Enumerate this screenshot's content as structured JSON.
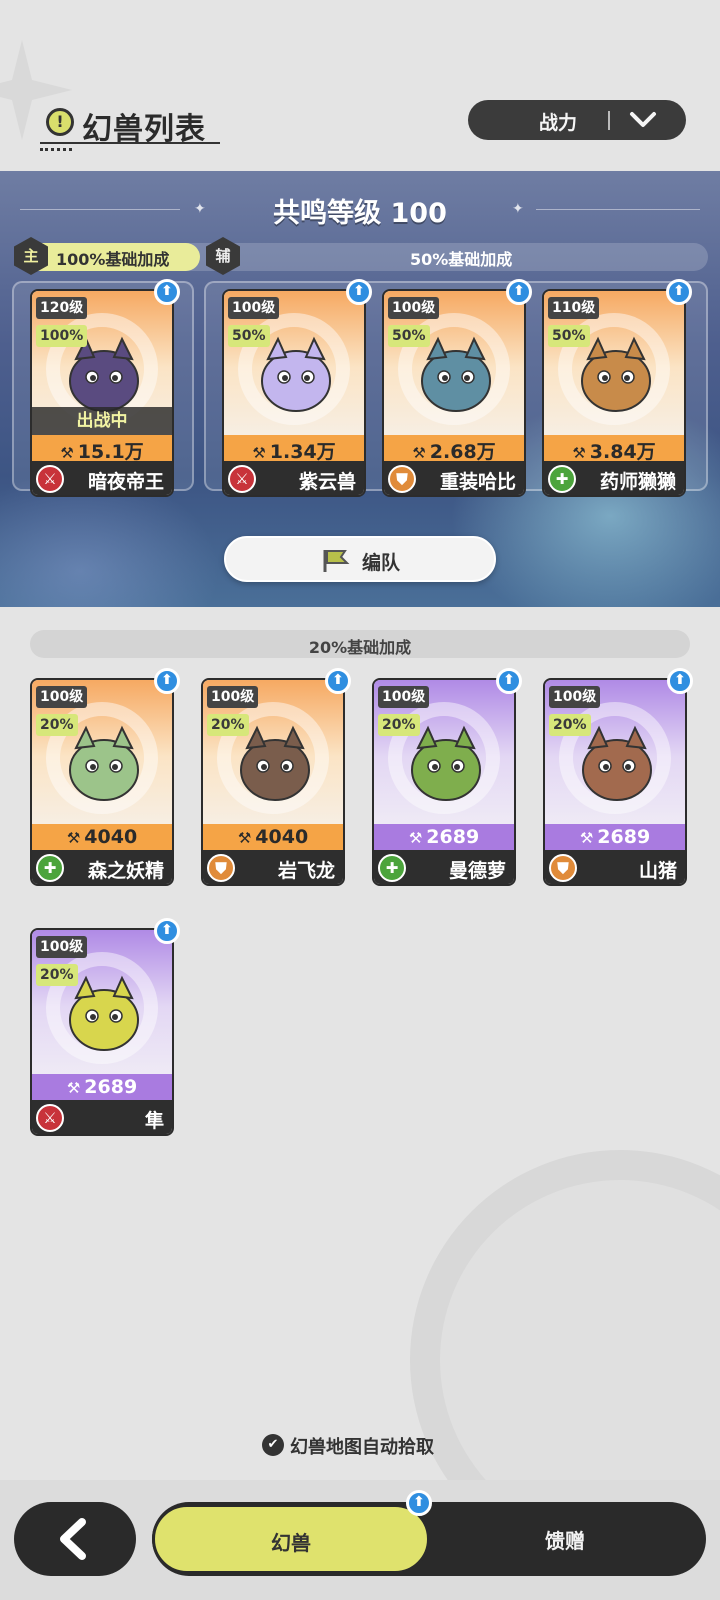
{
  "header": {
    "title": "幻兽列表",
    "title_icon": "!",
    "sort_label": "战力"
  },
  "resonance": {
    "title": "共鸣等级 100",
    "main_tag": "主",
    "main_bonus": "100%基础加成",
    "sub_tag": "辅",
    "sub_bonus": "50%基础加成",
    "team_button": "编队",
    "deployed_label": "出战中"
  },
  "main_cards": [
    {
      "level": "120级",
      "pct": "100%",
      "power": "15.1万",
      "name": "暗夜帝王",
      "role": "attack",
      "role_icon": "⚔",
      "theme": "orange",
      "color": "#5a4b80"
    }
  ],
  "sub_cards": [
    {
      "level": "100级",
      "pct": "50%",
      "power": "1.34万",
      "name": "紫云兽",
      "role": "attack",
      "role_icon": "⚔",
      "theme": "orange",
      "color": "#c3b6ee"
    },
    {
      "level": "100级",
      "pct": "50%",
      "power": "2.68万",
      "name": "重装哈比",
      "role": "defense",
      "role_icon": "⛊",
      "theme": "orange",
      "color": "#5f8fa3"
    },
    {
      "level": "110级",
      "pct": "50%",
      "power": "3.84万",
      "name": "药师獭獭",
      "role": "heal",
      "role_icon": "✚",
      "theme": "orange",
      "color": "#c88b4a"
    }
  ],
  "reserve": {
    "bonus": "20%基础加成",
    "cards": [
      {
        "level": "100级",
        "pct": "20%",
        "power": "4040",
        "name": "森之妖精",
        "role": "heal",
        "role_icon": "✚",
        "theme": "orange",
        "color": "#9cc48a"
      },
      {
        "level": "100级",
        "pct": "20%",
        "power": "4040",
        "name": "岩飞龙",
        "role": "defense",
        "role_icon": "⛊",
        "theme": "orange",
        "color": "#7a5d4c"
      },
      {
        "level": "100级",
        "pct": "20%",
        "power": "2689",
        "name": "曼德萝",
        "role": "heal",
        "role_icon": "✚",
        "theme": "purple",
        "color": "#7fae4d"
      },
      {
        "level": "100级",
        "pct": "20%",
        "power": "2689",
        "name": "山猪",
        "role": "defense",
        "role_icon": "⛊",
        "theme": "purple",
        "color": "#a26a4e"
      },
      {
        "level": "100级",
        "pct": "20%",
        "power": "2689",
        "name": "隼",
        "role": "attack",
        "role_icon": "⚔",
        "theme": "purple",
        "color": "#d8d64d"
      }
    ]
  },
  "footer": {
    "auto_pick": "幻兽地图自动拾取",
    "tab_active": "幻兽",
    "tab_other": "馈赠"
  },
  "icons": {
    "upgrade": "⬆",
    "power": "⚒",
    "check": "✔"
  }
}
